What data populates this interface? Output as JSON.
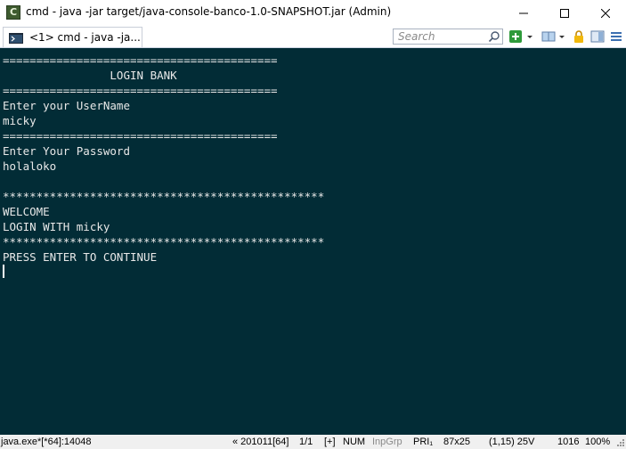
{
  "window": {
    "title": "cmd - java  -jar target/java-console-banco-1.0-SNAPSHOT.jar (Admin)",
    "icon_name": "conemu-app-icon"
  },
  "toolbar": {
    "tab_label": "<1> cmd - java  -ja...",
    "search_placeholder": "Search"
  },
  "console": {
    "lines": [
      "=========================================",
      "                LOGIN BANK",
      "=========================================",
      "Enter your UserName",
      "micky",
      "=========================================",
      "Enter Your Password",
      "holaloko",
      "",
      "************************************************",
      "WELCOME",
      "LOGIN WITH micky",
      "************************************************",
      "PRESS ENTER TO CONTINUE"
    ],
    "background": "#022c36",
    "text_color": "#e8e8e8"
  },
  "statusbar": {
    "process": "java.exe*[*64]:14048",
    "build": "« 201011[64]",
    "pages": "1/1",
    "plus": "[+]",
    "num": "NUM",
    "inp": "InpGrp",
    "pri": "PRI₁",
    "size": "87x25",
    "cursor": "(1,15) 25V",
    "count": "1016",
    "zoom": "100%"
  }
}
